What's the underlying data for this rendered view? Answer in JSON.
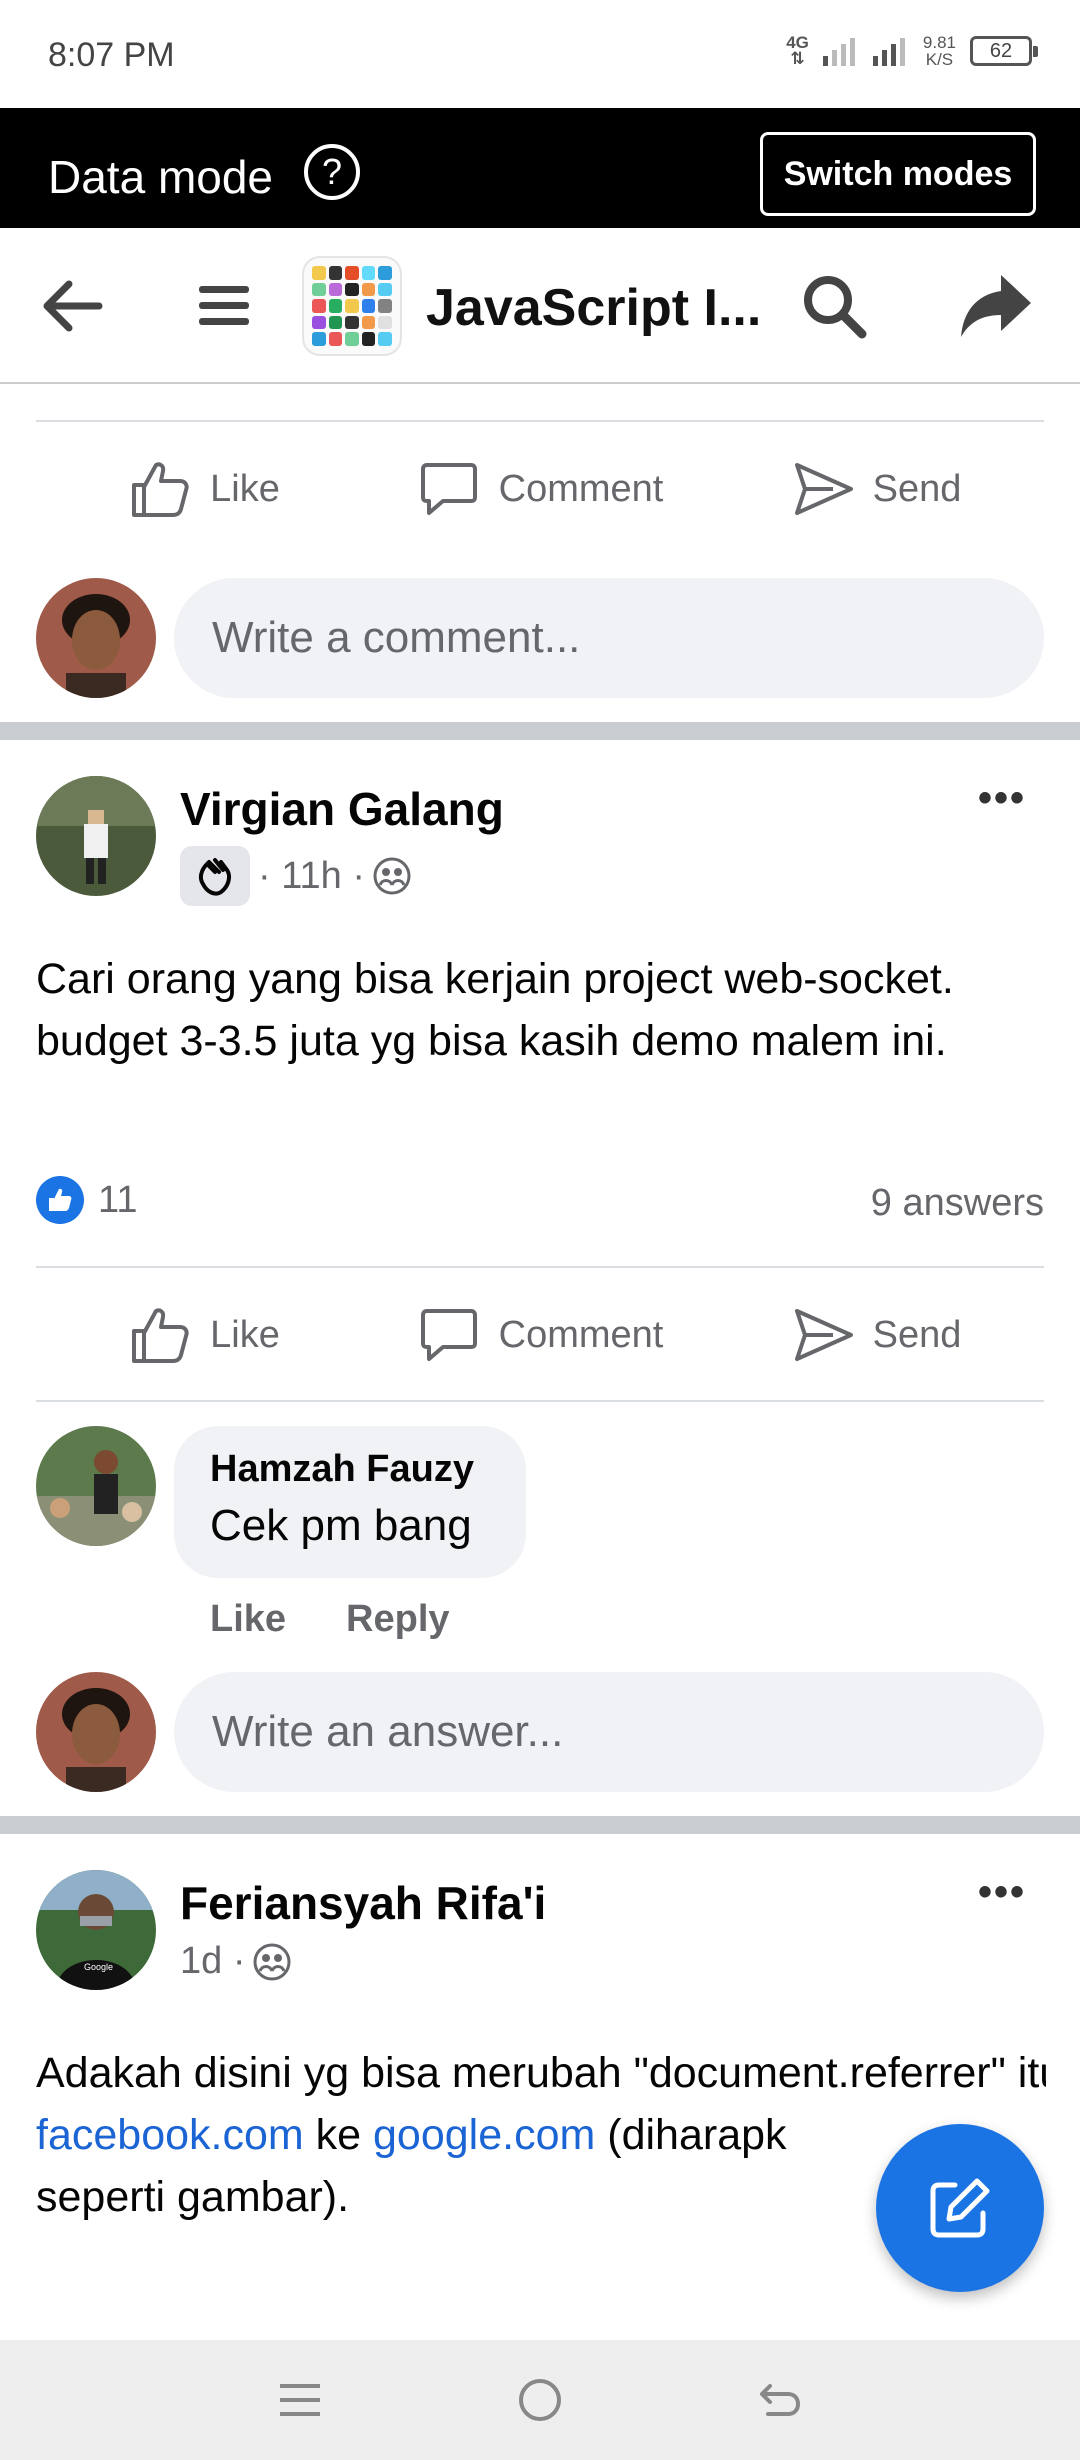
{
  "status_bar": {
    "time": "8:07 PM",
    "network": "4G",
    "speed_value": "9.81",
    "speed_unit": "K/S",
    "battery": "62"
  },
  "data_mode": {
    "label": "Data mode",
    "help_icon": "question-icon",
    "switch_label": "Switch modes"
  },
  "header": {
    "title": "JavaScript I...",
    "icons": [
      "back-arrow-icon",
      "menu-icon",
      "search-icon",
      "share-icon"
    ]
  },
  "actions": {
    "like": "Like",
    "comment": "Comment",
    "send": "Send"
  },
  "first_post": {
    "comment_placeholder": "Write a comment..."
  },
  "post1": {
    "author": "Virgian Galang",
    "time": "· 11h ·",
    "text": "Cari orang yang bisa kerjain project web-socket. budget 3-3.5 juta yg bisa kasih demo malem ini.",
    "like_count": "11",
    "answers": "9 answers",
    "reply": {
      "author": "Hamzah Fauzy",
      "text": "Cek pm bang",
      "like": "Like",
      "reply": "Reply"
    },
    "answer_placeholder": "Write an answer..."
  },
  "post2": {
    "author": "Feriansyah Rifa'i",
    "time": "1d ·",
    "text_1": "Adakah disini yg bisa merubah \"document.referrer\" itu value dari",
    "link_1": "facebook.com",
    "text_2": " ke ",
    "link_2": "google.com",
    "text_3": " (diharapk",
    "text_4": "seperti gambar)."
  },
  "colors": {
    "accent": "#1b74e4",
    "link": "#1b64d4",
    "muted": "#65676b"
  }
}
